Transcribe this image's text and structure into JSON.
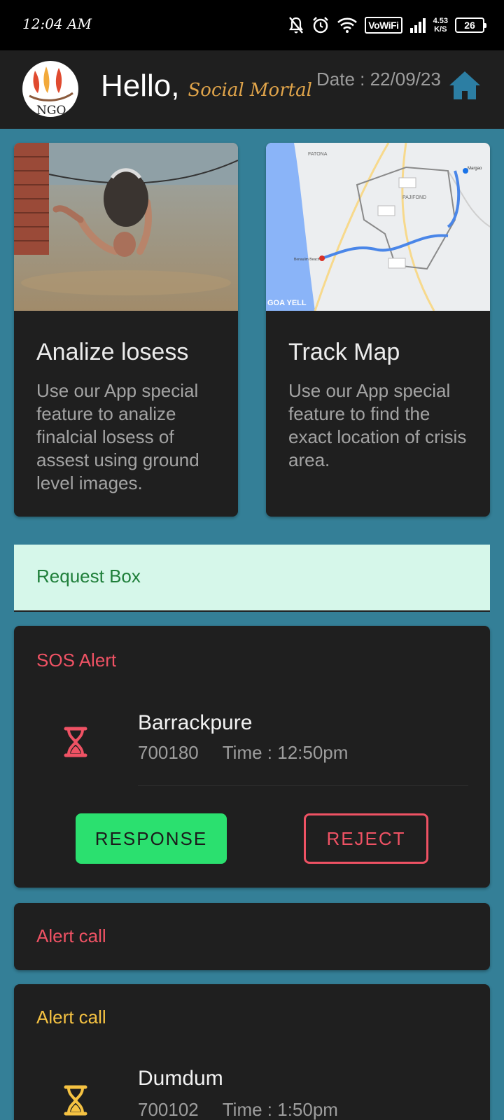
{
  "status_bar": {
    "time": "12:04 AM",
    "vowifi": "VoWiFi",
    "speed_value": "4.53",
    "speed_unit": "K/S",
    "battery": "26",
    "icons": [
      "mute-bell-icon",
      "alarm-icon",
      "wifi-icon",
      "signal-icon"
    ]
  },
  "header": {
    "logo_text": "NGO",
    "greeting": "Hello,",
    "username": "Social Mortal",
    "date": "Date : 22/09/23",
    "home_icon": "home-icon"
  },
  "cards": [
    {
      "title": "Analize losess",
      "description": "Use our App special feature to analize finalcial losess of assest using ground level images."
    },
    {
      "title": "Track Map",
      "description": "Use our App special feature to find the exact location of crisis area.",
      "map_labels": {
        "watermark": "GOA YELL",
        "place_1": "FATONA",
        "place_2": "PAJIFOND",
        "place_3": "Margao",
        "beach": "Benaulim Beach"
      }
    }
  ],
  "request_box": {
    "label": "Request Box"
  },
  "alerts": [
    {
      "title": "SOS Alert",
      "place": "Barrackpure",
      "pincode": "700180",
      "time": "Time : 12:50pm",
      "response_label": "RESPONSE",
      "reject_label": "REJECT"
    },
    {
      "title": "Alert call"
    },
    {
      "title": "Alert call",
      "place": "Dumdum",
      "pincode": "700102",
      "time": "Time : 1:50pm"
    }
  ],
  "colors": {
    "background": "#347f97",
    "surface": "#1f1f1f",
    "sos": "#ef5264",
    "alert_yellow": "#f5c242",
    "response_green": "#2be06f",
    "request_bg": "#d6f7ea",
    "request_text": "#1f7f3a",
    "username": "#e0a44a"
  }
}
